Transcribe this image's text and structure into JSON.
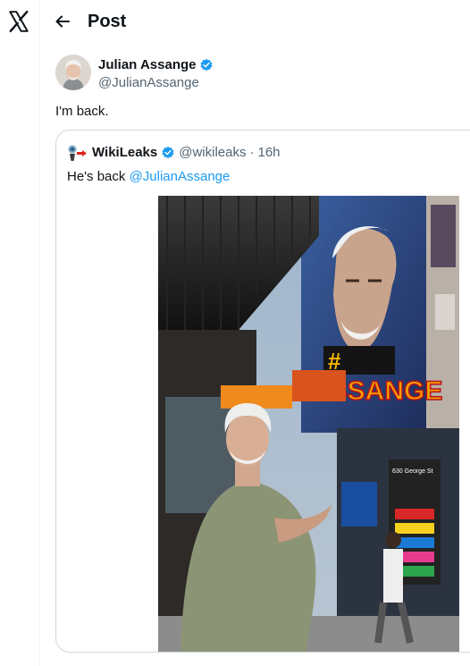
{
  "header": {
    "title": "Post",
    "back_icon": "arrow-left-icon",
    "logo_icon": "x-logo-icon"
  },
  "post": {
    "author_name": "Julian Assange",
    "author_handle": "@JulianAssange",
    "verified_icon": "verified-badge-icon",
    "text": "I'm back."
  },
  "quote": {
    "name": "WikiLeaks",
    "handle": "@wikileaks",
    "separator": "·",
    "time": "16h",
    "text_prefix": "He's back ",
    "mention": "@JulianAssange",
    "logo_icon": "wikileaks-logo-icon",
    "photo": {
      "mural_text": "ASSANGE",
      "mural_hashtag": "#",
      "sign_text": "630 George St"
    }
  },
  "colors": {
    "accent": "#1d9bf0",
    "text_primary": "#0f1419",
    "text_secondary": "#536471",
    "border": "#cfd9de"
  }
}
